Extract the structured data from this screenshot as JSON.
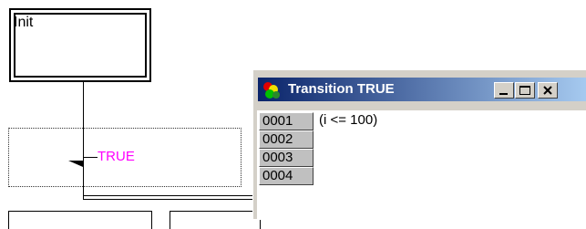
{
  "diagram": {
    "init_step_label": "Init",
    "transition_label": "TRUE"
  },
  "transition_window": {
    "title": "Transition TRUE",
    "title_icon": "traffic-light-icon",
    "buttons": [
      "minimize",
      "maximize",
      "close"
    ],
    "line_numbers": [
      "0001",
      "0002",
      "0003",
      "0004"
    ],
    "code_lines": [
      "(i <= 100)",
      "",
      "",
      ""
    ]
  },
  "colors": {
    "transition_label": "#ff00ff",
    "title_bar_start": "#0a246a",
    "title_bar_end": "#a6caf0",
    "window_face": "#d4d0c8",
    "gutter": "#c0c0c0"
  }
}
